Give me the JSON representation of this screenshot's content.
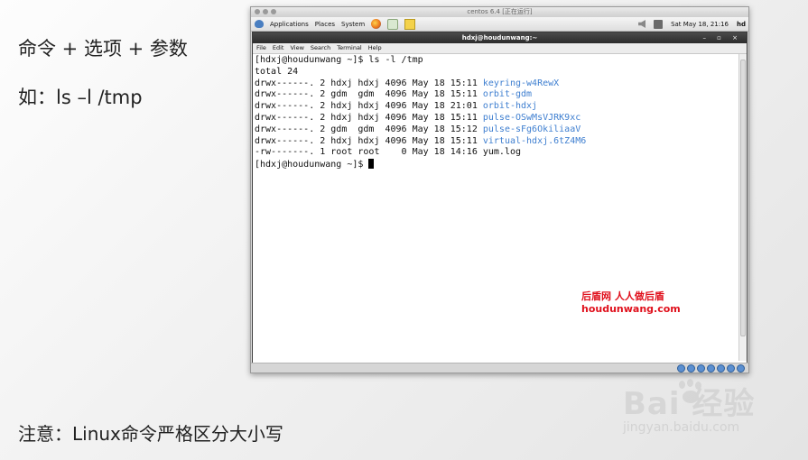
{
  "slide": {
    "line1": "命令 + 选项 + 参数",
    "line2": "如：ls –l /tmp",
    "note": "注意：Linux命令严格区分大小写"
  },
  "vm": {
    "title": "centos 6.4 [正在运行]"
  },
  "gnome_panel": {
    "applications": "Applications",
    "places": "Places",
    "system": "System",
    "datetime": "Sat May 18, 21:16",
    "user": "hd"
  },
  "terminal": {
    "title": "hdxj@houdunwang:~",
    "controls": "– ▫ ×",
    "menu": [
      "File",
      "Edit",
      "View",
      "Search",
      "Terminal",
      "Help"
    ],
    "lines": [
      {
        "text": "[hdxj@houdunwang ~]$ ls -l /tmp",
        "dir": ""
      },
      {
        "text": "total 24",
        "dir": ""
      },
      {
        "text": "drwx------. 2 hdxj hdxj 4096 May 18 15:11 ",
        "dir": "keyring-w4RewX"
      },
      {
        "text": "drwx------. 2 gdm  gdm  4096 May 18 15:11 ",
        "dir": "orbit-gdm"
      },
      {
        "text": "drwx------. 2 hdxj hdxj 4096 May 18 21:01 ",
        "dir": "orbit-hdxj"
      },
      {
        "text": "drwx------. 2 hdxj hdxj 4096 May 18 15:11 ",
        "dir": "pulse-OSwMsVJRK9xc"
      },
      {
        "text": "drwx------. 2 gdm  gdm  4096 May 18 15:12 ",
        "dir": "pulse-sFg6OkiliaaV"
      },
      {
        "text": "drwx------. 2 hdxj hdxj 4096 May 18 15:11 ",
        "dir": "virtual-hdxj.6tZ4M6"
      },
      {
        "text": "-rw-------. 1 root root    0 May 18 14:16 yum.log",
        "dir": ""
      },
      {
        "text": "[hdxj@houdunwang ~]$ ",
        "dir": "",
        "cursor": true
      }
    ]
  },
  "watermark": {
    "line1": "后盾网 人人做后盾",
    "line2": "houdunwang.com"
  },
  "baidu": {
    "logo": "Bai  经验",
    "sub": "jingyan.baidu.com"
  }
}
